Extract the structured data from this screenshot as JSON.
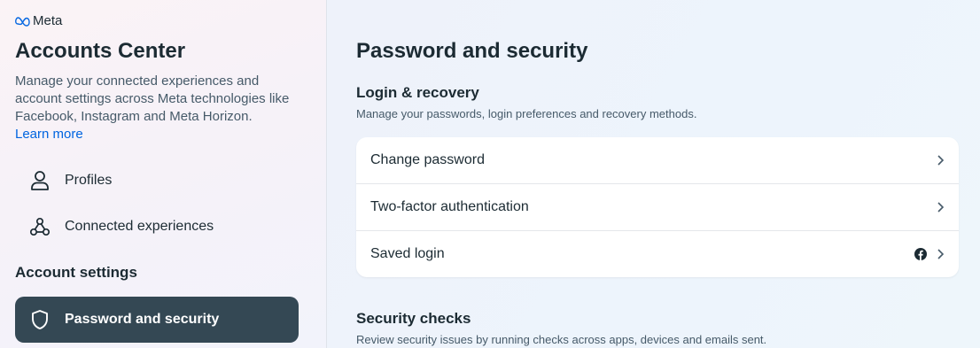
{
  "sidebar": {
    "brand": "Meta",
    "title": "Accounts Center",
    "description": "Manage your connected experiences and account settings across Meta technologies like Facebook, Instagram and Meta Horizon.",
    "learn_more": "Learn more",
    "items": [
      {
        "label": "Profiles",
        "icon": "person-icon"
      },
      {
        "label": "Connected experiences",
        "icon": "connected-nodes-icon"
      }
    ],
    "section_label": "Account settings",
    "active_item": {
      "label": "Password and security",
      "icon": "shield-icon"
    }
  },
  "main": {
    "title": "Password and security",
    "login_recovery": {
      "title": "Login & recovery",
      "description": "Manage your passwords, login preferences and recovery methods.",
      "rows": [
        {
          "label": "Change password"
        },
        {
          "label": "Two-factor authentication"
        },
        {
          "label": "Saved login",
          "badge_icon": "facebook-icon"
        }
      ]
    },
    "security_checks": {
      "title": "Security checks",
      "description": "Review security issues by running checks across apps, devices and emails sent."
    }
  },
  "colors": {
    "active_bg": "#344854",
    "link": "#0064e0",
    "text": "#1c2b33",
    "muted": "#465a69"
  }
}
